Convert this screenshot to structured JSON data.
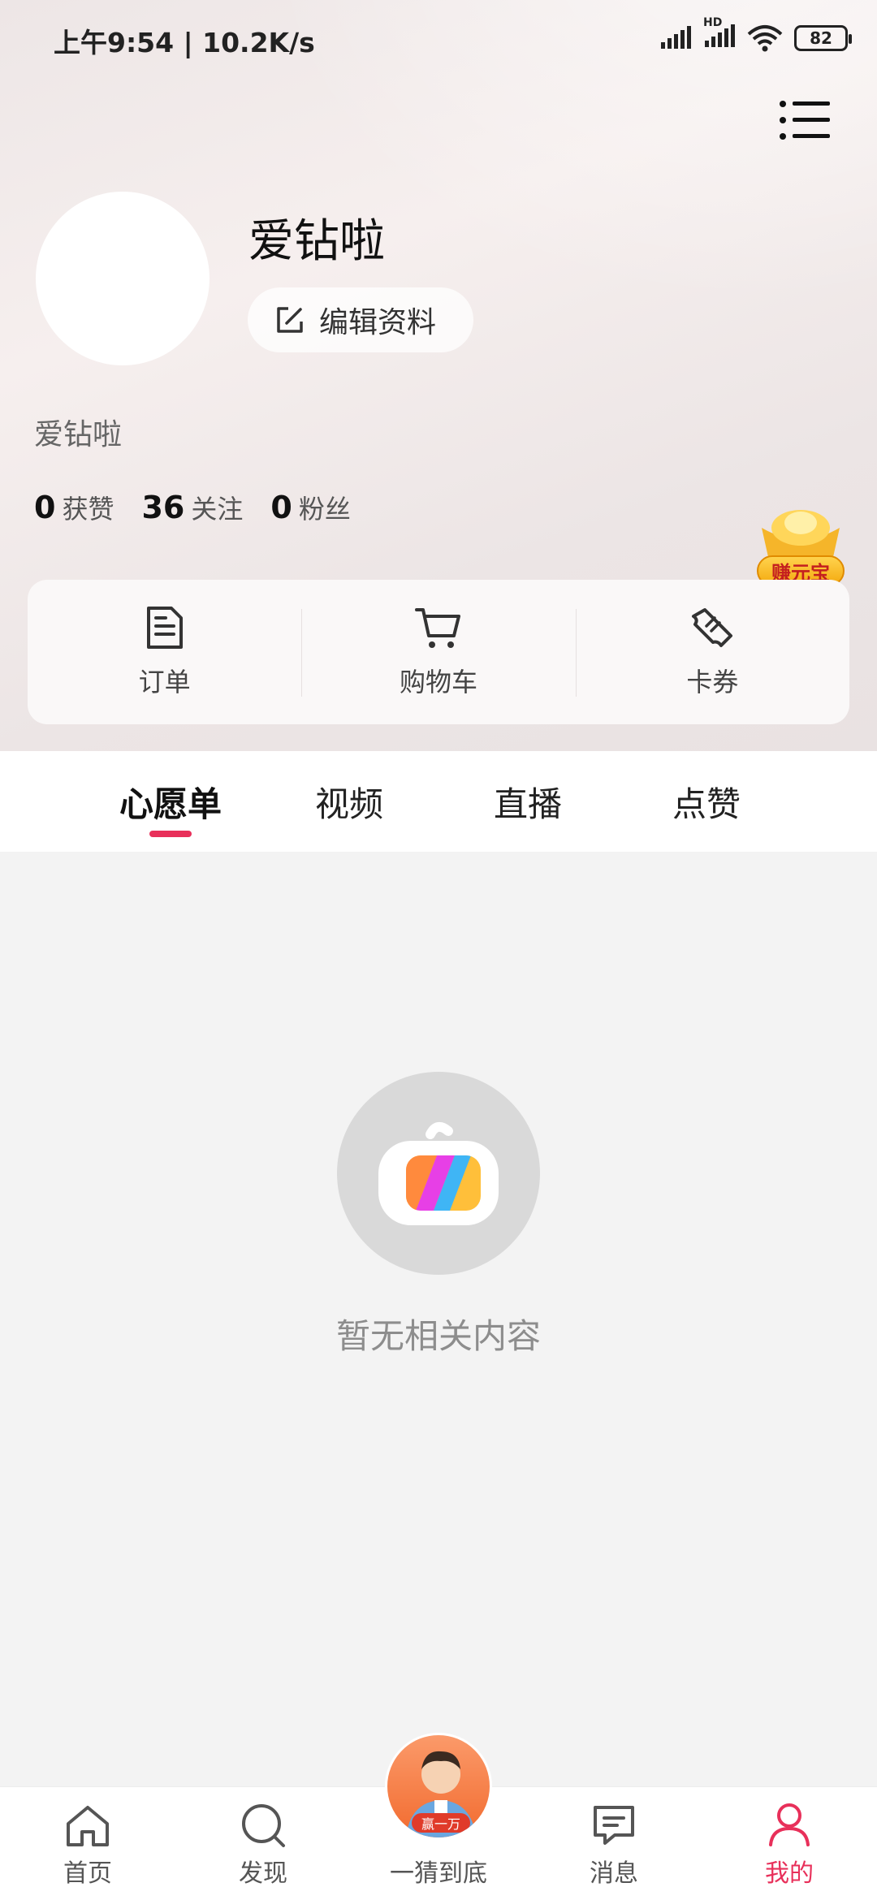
{
  "status_bar": {
    "time_text": "上午9:54 | 10.2K/s",
    "battery": "82",
    "network": "HD"
  },
  "profile": {
    "username": "爱钻啦",
    "edit_label": "编辑资料",
    "bio": "爱钻啦",
    "stats": [
      {
        "value": "0",
        "label": "获赞"
      },
      {
        "value": "36",
        "label": "关注"
      },
      {
        "value": "0",
        "label": "粉丝"
      }
    ],
    "earn_badge": "赚元宝"
  },
  "shortcuts": [
    {
      "label": "订单",
      "icon": "order-icon"
    },
    {
      "label": "购物车",
      "icon": "cart-icon"
    },
    {
      "label": "卡券",
      "icon": "coupon-icon"
    }
  ],
  "tabs": [
    {
      "label": "心愿单",
      "active": true
    },
    {
      "label": "视频",
      "active": false
    },
    {
      "label": "直播",
      "active": false
    },
    {
      "label": "点赞",
      "active": false
    }
  ],
  "empty_state": {
    "text": "暂无相关内容"
  },
  "bottom_nav": {
    "items": [
      {
        "label": "首页",
        "icon": "home-icon"
      },
      {
        "label": "发现",
        "icon": "discover-icon"
      },
      {
        "label": "一猜到底",
        "icon": "guess-avatar"
      },
      {
        "label": "消息",
        "icon": "message-icon"
      },
      {
        "label": "我的",
        "icon": "profile-icon",
        "active": true
      }
    ],
    "center_badge": "赢一万"
  },
  "colors": {
    "accent": "#e8305a",
    "header_bg": "#efe8e8",
    "page_bg": "#f3f3f3"
  }
}
